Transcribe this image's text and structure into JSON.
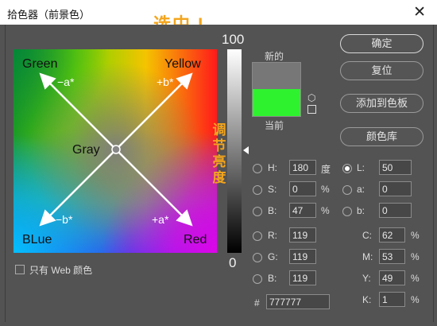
{
  "dialog": {
    "title": "拾色器（前景色）",
    "close_glyph": "✕"
  },
  "annotations": {
    "selected": "选中 L",
    "adjust_brightness": [
      "调",
      "节",
      "亮",
      "度"
    ]
  },
  "field": {
    "labels": {
      "green": "Green",
      "yellow": "Yellow",
      "blue": "BLue",
      "red": "Red",
      "gray": "Gray",
      "minus_a": "−a*",
      "plus_b": "+b*",
      "minus_b": "−b*",
      "plus_a": "+a*"
    }
  },
  "slider": {
    "top_label": "100",
    "bottom_label": "0",
    "level_fraction": 0.5
  },
  "swatches": {
    "new_label": "新的",
    "current_label": "当前",
    "new_color": "#777777",
    "current_color": "#2ff22f"
  },
  "icons": {
    "cube": "cube-icon",
    "web": "web-safe-icon"
  },
  "buttons": {
    "ok": "确定",
    "reset": "复位",
    "add_to_swatches": "添加到色板",
    "color_library": "颜色库"
  },
  "hsb": {
    "h": {
      "label": "H:",
      "value": "180",
      "unit": "度"
    },
    "s": {
      "label": "S:",
      "value": "0",
      "unit": "%"
    },
    "b": {
      "label": "B:",
      "value": "47",
      "unit": "%"
    }
  },
  "lab": {
    "l": {
      "label": "L:",
      "value": "50",
      "selected": true
    },
    "a": {
      "label": "a:",
      "value": "0"
    },
    "b": {
      "label": "b:",
      "value": "0"
    }
  },
  "rgb": {
    "r": {
      "label": "R:",
      "value": "119"
    },
    "g": {
      "label": "G:",
      "value": "119"
    },
    "b": {
      "label": "B:",
      "value": "119"
    }
  },
  "cmyk": {
    "c": {
      "label": "C:",
      "value": "62",
      "unit": "%"
    },
    "m": {
      "label": "M:",
      "value": "53",
      "unit": "%"
    },
    "y": {
      "label": "Y:",
      "value": "49",
      "unit": "%"
    },
    "k": {
      "label": "K:",
      "value": "1",
      "unit": "%"
    }
  },
  "hex": {
    "label": "#",
    "value": "777777"
  },
  "web_only": {
    "label": "只有 Web 颜色",
    "checked": false
  }
}
